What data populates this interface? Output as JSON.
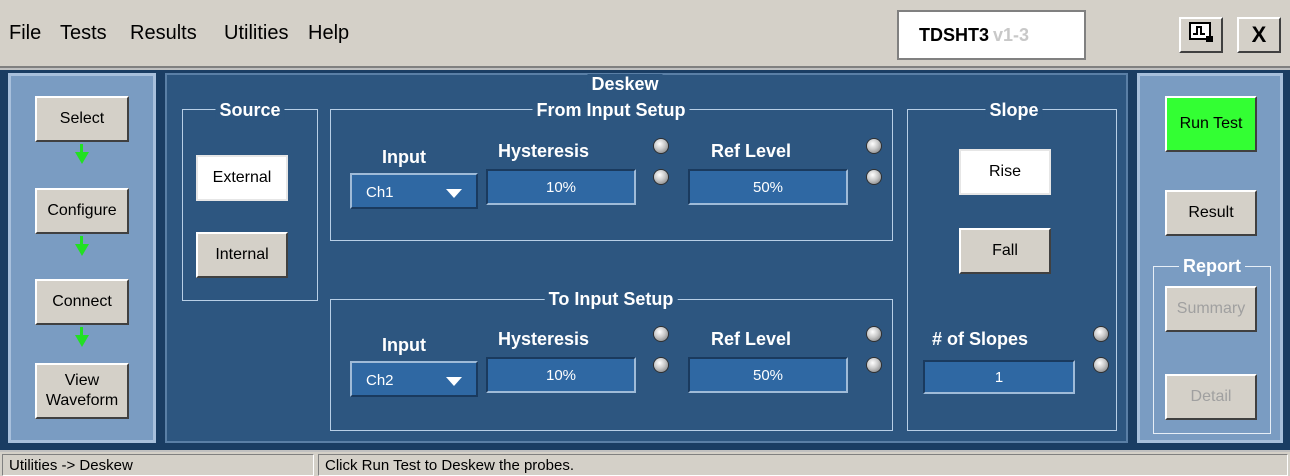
{
  "menubar": {
    "items": [
      "File",
      "Tests",
      "Results",
      "Utilities",
      "Help"
    ],
    "app_name": "TDSHT3",
    "app_version": "v1-3",
    "minimize_icon": "waveform-minimize-icon",
    "close_label": "X"
  },
  "left_nav": {
    "select": "Select",
    "configure": "Configure",
    "connect": "Connect",
    "view_waveform": "View Waveform"
  },
  "deskew": {
    "title": "Deskew",
    "source": {
      "title": "Source",
      "external": "External",
      "internal": "Internal",
      "selected": "External"
    },
    "from_setup": {
      "title": "From Input Setup",
      "input_label": "Input",
      "input_value": "Ch1",
      "hysteresis_label": "Hysteresis",
      "hysteresis_value": "10%",
      "ref_level_label": "Ref Level",
      "ref_level_value": "50%"
    },
    "to_setup": {
      "title": "To Input Setup",
      "input_label": "Input",
      "input_value": "Ch2",
      "hysteresis_label": "Hysteresis",
      "hysteresis_value": "10%",
      "ref_level_label": "Ref Level",
      "ref_level_value": "50%"
    },
    "slope": {
      "title": "Slope",
      "rise": "Rise",
      "fall": "Fall",
      "selected": "Rise",
      "num_slopes_label": "# of Slopes",
      "num_slopes_value": "1"
    }
  },
  "right_nav": {
    "run_test": "Run Test",
    "result": "Result",
    "report_title": "Report",
    "summary": "Summary",
    "detail": "Detail"
  },
  "statusbar": {
    "path": "Utilities -> Deskew",
    "message": "Click Run Test to Deskew the probes."
  },
  "colors": {
    "run_test_bg": "#33ff33",
    "panel_bg": "#2d5680",
    "field_bg": "#2f68a3",
    "arrow": "#22e022"
  }
}
